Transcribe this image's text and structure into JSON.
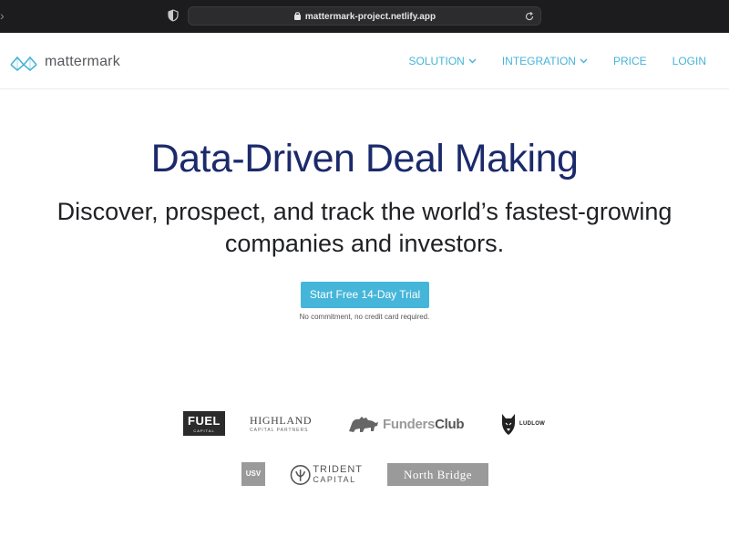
{
  "browser": {
    "url": "mattermark-project.netlify.app",
    "back_icon": "chevron-left-icon",
    "shield_icon": "shield-icon",
    "lock_icon": "lock-icon",
    "reload_icon": "reload-icon"
  },
  "header": {
    "logo_text": "mattermark",
    "nav": [
      {
        "label": "SOLUTION",
        "has_dropdown": true
      },
      {
        "label": "INTEGRATION",
        "has_dropdown": true
      },
      {
        "label": "PRICE",
        "has_dropdown": false
      },
      {
        "label": "LOGIN",
        "has_dropdown": false
      }
    ]
  },
  "hero": {
    "title": "Data-Driven Deal Making",
    "subtitle": "Discover, prospect, and track the world’s fastest-growing companies and investors.",
    "cta_label": "Start Free 14-Day Trial",
    "note": "No commitment, no credit card required."
  },
  "partners": {
    "fuel": {
      "big": "FUEL",
      "small": "CAPITAL"
    },
    "highland": {
      "big": "HIGHLAND",
      "small": "CAPITAL PARTNERS"
    },
    "funders": {
      "part1": "Funders",
      "part2": "Club"
    },
    "ludlow": {
      "text": "LUDLOW"
    },
    "usv": {
      "text": "USV"
    },
    "trident": {
      "line1": "TRIDENT",
      "line2": "CAPITAL"
    },
    "northbridge": {
      "text": "North Bridge"
    }
  },
  "colors": {
    "accent": "#45b6d9",
    "title": "#1b2a6b",
    "chrome": "#1c1c1e"
  }
}
